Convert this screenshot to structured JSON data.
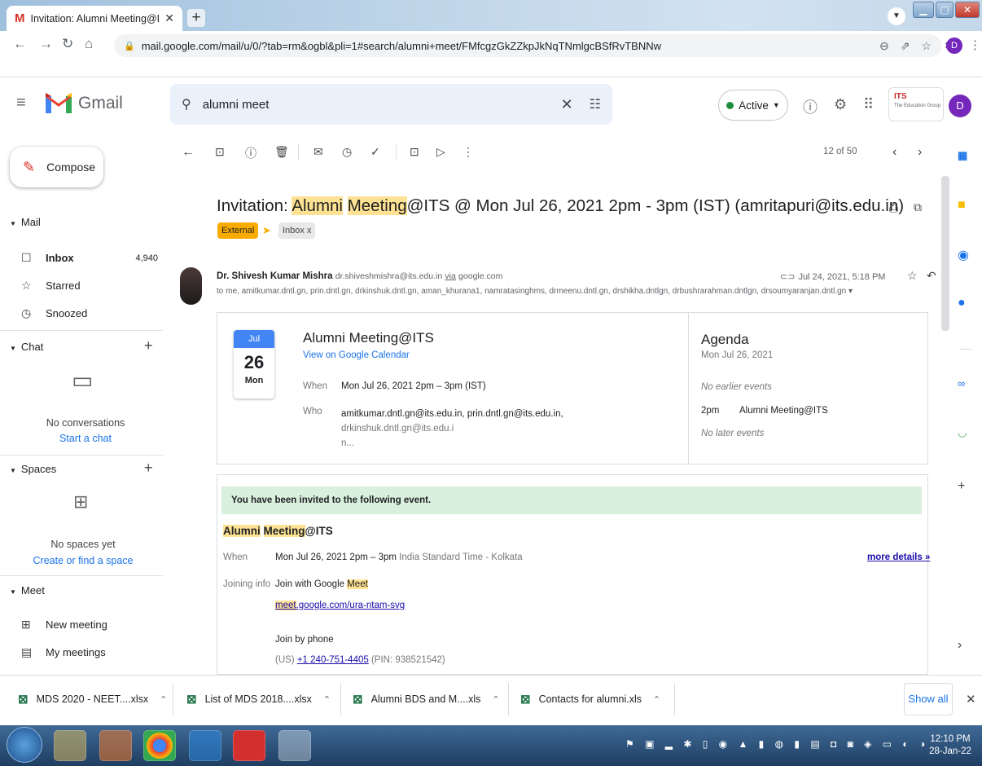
{
  "browser": {
    "tab_title": "Invitation: Alumni Meeting@ITS",
    "url": "mail.google.com/mail/u/0/?tab=rm&ogbl&pli=1#search/alumni+meet/FMfcgzGkZZkpJkNqTNmlgcBSfRvTBNNw",
    "profile_initial": "D"
  },
  "header": {
    "app_name": "Gmail",
    "search_value": "alumni meet",
    "status": "Active",
    "org_logo": "ITS",
    "org_subtitle": "The Education Group",
    "avatar_initial": "D"
  },
  "sidebar": {
    "compose_label": "Compose",
    "mail_section": "Mail",
    "items": [
      {
        "label": "Inbox",
        "count": "4,940",
        "icon": "inbox-icon"
      },
      {
        "label": "Starred",
        "icon": "star-icon"
      },
      {
        "label": "Snoozed",
        "icon": "clock-icon"
      }
    ],
    "chat_section": "Chat",
    "chat_empty": "No conversations",
    "chat_link": "Start a chat",
    "spaces_section": "Spaces",
    "spaces_empty": "No spaces yet",
    "spaces_link": "Create or find a space",
    "meet_section": "Meet",
    "meet_items": [
      {
        "label": "New meeting",
        "icon": "video-plus-icon"
      },
      {
        "label": "My meetings",
        "icon": "calendar-icon"
      }
    ]
  },
  "toolbar": {
    "page_count": "12 of 50"
  },
  "email": {
    "subject_pre": "Invitation: ",
    "subject_hl1": "Alumni",
    "subject_sp": " ",
    "subject_hl2": "Meeting",
    "subject_post": "@ITS @ Mon Jul 26, 2021 2pm - 3pm (IST) (amritapuri@its.edu.in)",
    "label_external": "External",
    "label_inbox": "Inbox",
    "sender_name": "Dr. Shivesh Kumar Mishra",
    "sender_email": "dr.shiveshmishra@its.edu.in",
    "via": "via",
    "via_domain": "google.com",
    "to_line": "to me, amitkumar.dntl.gn, prin.dntl.gn, drkinshuk.dntl.gn, aman_khurana1, namratasinghms, drmeenu.dntl.gn, drshikha.dntlgn, drbushrarahman.dntlgn, drsoumyaranjan.dntl.gn",
    "date": "Jul 24, 2021, 5:18 PM"
  },
  "calendar_card": {
    "month": "Jul",
    "day": "26",
    "weekday": "Mon",
    "title": "Alumni Meeting@ITS",
    "view_link": "View on Google Calendar",
    "when_label": "When",
    "when_value": "Mon Jul 26, 2021 2pm – 3pm (IST)",
    "who_label": "Who",
    "who_value_1": "amitkumar.dntl.gn@its.edu.in, prin.dntl.gn@its.edu.in, ",
    "who_value_2": "drkinshuk.dntl.gn@its.edu.i",
    "who_value_3": "n...",
    "agenda_title": "Agenda",
    "agenda_date": "Mon Jul 26, 2021",
    "no_earlier": "No earlier events",
    "event_time": "2pm",
    "event_name": "Alumni Meeting@ITS",
    "no_later": "No later events"
  },
  "invite": {
    "banner": "You have been invited to the following event.",
    "title_hl1": "Alumni",
    "title_hl2": "Meeting",
    "title_post": "@ITS",
    "when_label": "When",
    "when_value": "Mon Jul 26, 2021 2pm – 3pm",
    "timezone": "India Standard Time - Kolkata",
    "more_details": "more details »",
    "joining_label": "Joining info",
    "join_text": "Join with Google ",
    "join_hl": "Meet",
    "meet_link_hl": "meet",
    "meet_link_rest": ".google.com/ura-ntam-svg",
    "phone_label": "Join by phone",
    "phone_country": "(US) ",
    "phone_number": "+1 240-751-4405",
    "phone_pin": " (PIN: 938521542)"
  },
  "downloads": [
    {
      "name": "MDS 2020 - NEET....xlsx"
    },
    {
      "name": "List of MDS 2018....xlsx"
    },
    {
      "name": "Alumni BDS and M....xls"
    },
    {
      "name": "Contacts for alumni.xls"
    }
  ],
  "downloads_show_all": "Show all",
  "taskbar": {
    "time": "12:10 PM",
    "date": "28-Jan-22"
  }
}
